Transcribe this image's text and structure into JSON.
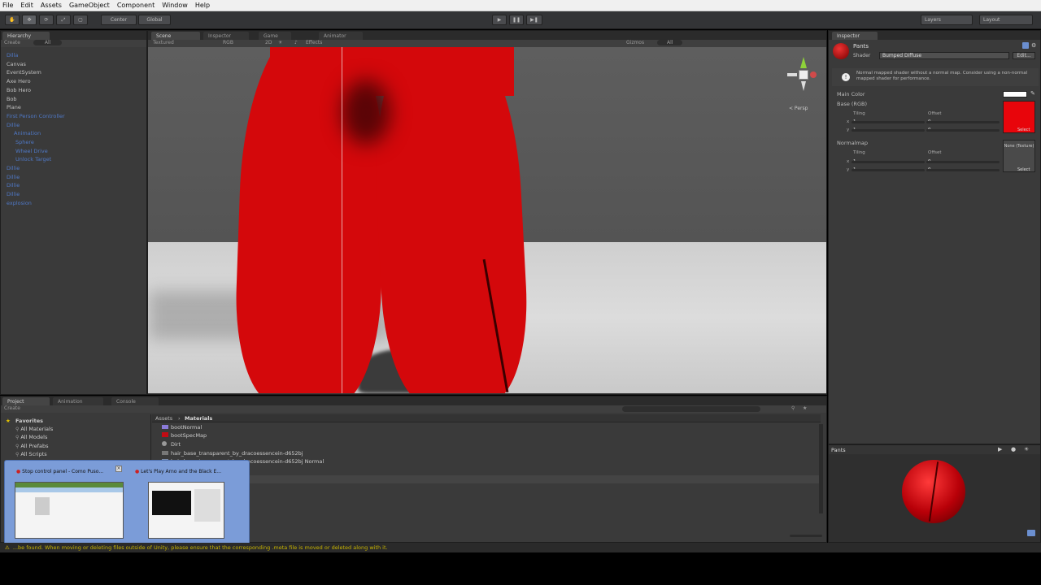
{
  "menu": [
    "File",
    "Edit",
    "Assets",
    "GameObject",
    "Component",
    "Window",
    "Help"
  ],
  "toolbar": {
    "center": "Center",
    "global": "Global",
    "layers": "Layers",
    "layout": "Layout"
  },
  "hierarchy": {
    "tab": "Hierarchy",
    "create": "Create",
    "search": "All",
    "items": [
      "Dilla",
      "Canvas",
      "EventSystem",
      "Axe Hero",
      "Bob Hero",
      "Bob",
      "Plane",
      "First Person Controller",
      "Dillie",
      "Animation",
      "Sphere",
      "Wheel Drive",
      "Unlock Target",
      "Dillie",
      "Dillie",
      "Dillie",
      "Dillie",
      "explosion"
    ]
  },
  "scene": {
    "tabs": [
      "Scene",
      "Inspector",
      "Game",
      "Animator"
    ],
    "draw_mode": "Textured",
    "render_mode": "RGB",
    "gizmos": "Gizmos",
    "effects": "Effects",
    "persp": "< Persp",
    "search": "All"
  },
  "inspector": {
    "tab": "Inspector",
    "name": "Pants",
    "shader_label": "Shader",
    "shader": "Bumped Diffuse",
    "edit": "Edit...",
    "info": "Normal mapped shader without a normal map. Consider using a non-normal mapped shader for performance.",
    "main_color": "Main Color",
    "base": "Base (RGB)",
    "tiling": "Tiling",
    "offset": "Offset",
    "normalmap": "Normalmap",
    "none_texture": "None (Texture)",
    "select": "Select",
    "x": "x",
    "y": "y",
    "v1": "1",
    "v0": "0"
  },
  "preview": {
    "label": "Pants"
  },
  "project": {
    "tabs": [
      "Project",
      "Animation",
      "Console"
    ],
    "create": "Create",
    "favorites": "Favorites",
    "fav_items": [
      "All Materials",
      "All Models",
      "All Prefabs",
      "All Scripts"
    ],
    "breadcrumb": [
      "Assets",
      "Materials"
    ],
    "files": [
      "bootNormal",
      "bootSpecMap",
      "Dirt",
      "hair_base_transparent_by_dracoessencein-d652bj",
      "hair_base_transparent_by_dracoessencein-d652bj Normal"
    ]
  },
  "taskbar": {
    "thumb1": "Stop control panel - Como Puso...",
    "thumb2": "Let's Play Arno and the Black E..."
  },
  "status": "...be found. When moving or deleting files outside of Unity, please ensure that the corresponding .meta file is moved or deleted along with it.",
  "colors": {
    "pants": "#d4080b",
    "bg_panel": "#3a3a3a",
    "status": "#c8b400"
  }
}
